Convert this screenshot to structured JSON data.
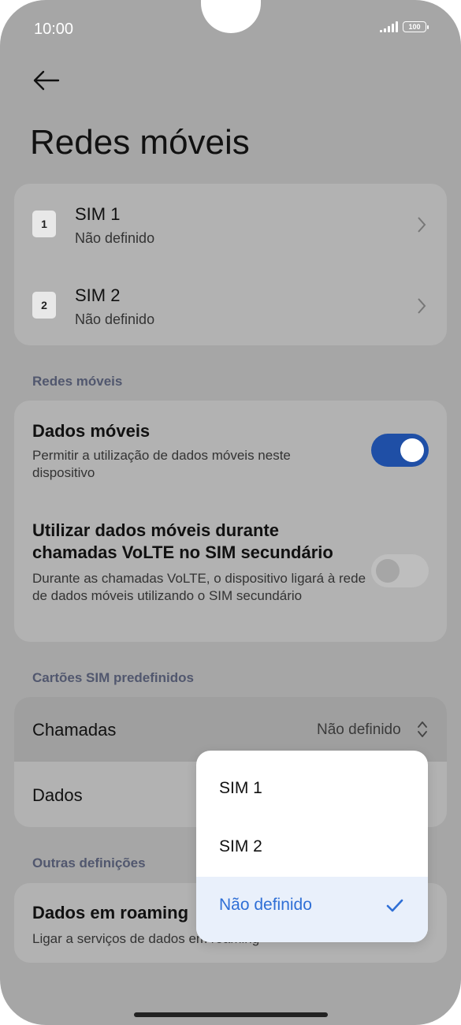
{
  "status_bar": {
    "time": "10:00",
    "battery": "100"
  },
  "header": {
    "title": "Redes móveis"
  },
  "sim_cards": [
    {
      "badge": "1",
      "title": "SIM 1",
      "subtitle": "Não definido"
    },
    {
      "badge": "2",
      "title": "SIM 2",
      "subtitle": "Não definido"
    }
  ],
  "mobile_networks": {
    "section_label": "Redes móveis",
    "mobile_data": {
      "title": "Dados móveis",
      "description": "Permitir a utilização de dados móveis neste dispositivo",
      "enabled": true
    },
    "volte_data": {
      "title": "Utilizar dados móveis durante chamadas VoLTE no SIM secundário",
      "description": "Durante as chamadas VoLTE, o dispositivo ligará à rede de dados móveis utilizando o SIM secundário",
      "enabled": false
    }
  },
  "default_sims": {
    "section_label": "Cartões SIM predefinidos",
    "calls": {
      "title": "Chamadas",
      "value": "Não definido"
    },
    "data": {
      "title": "Dados"
    }
  },
  "other_settings": {
    "section_label": "Outras definições",
    "roaming": {
      "title": "Dados em roaming",
      "description": "Ligar a serviços de dados em roaming"
    }
  },
  "dropdown": {
    "options": [
      "SIM 1",
      "SIM 2",
      "Não definido"
    ],
    "selected_index": 2
  },
  "colors": {
    "accent": "#2f6fd6",
    "toggle_on": "#1f4fa6"
  }
}
